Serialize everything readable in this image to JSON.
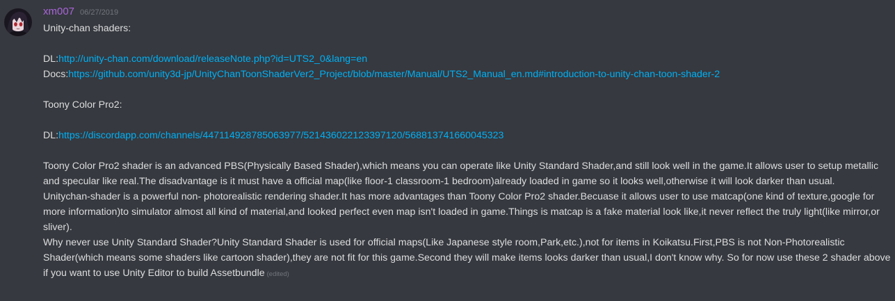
{
  "message": {
    "author": {
      "name": "xm007",
      "color": "#a865d8",
      "avatar": "anime-avatar"
    },
    "timestamp": "06/27/2019",
    "edited_label": "(edited)",
    "lines": {
      "l1": "Unity-chan shaders:",
      "dl1_label": "DL:",
      "dl1_link": "http://unity-chan.com/download/releaseNote.php?id=UTS2_0&lang=en",
      "docs_label": "Docs:",
      "docs_link": "https://github.com/unity3d-jp/UnityChanToonShaderVer2_Project/blob/master/Manual/UTS2_Manual_en.md#introduction-to-unity-chan-toon-shader-2",
      "l2": "Toony Color Pro2:",
      "dl2_label": "DL:",
      "dl2_link": "https://discordapp.com/channels/447114928785063977/521436022123397120/568813741660045323",
      "p1": "Toony Color Pro2 shader is an advanced PBS(Physically Based Shader),which means you can operate like Unity Standard Shader,and still look well in the game.It allows user to setup metallic and specular like real.The disadvantage is it must have a official map(like floor-1 classroom-1 bedroom)already loaded in game so it looks well,otherwise it will look darker than usual.",
      "p2": "Unitychan-shader is a powerful non- photorealistic rendering shader.It has more advantages than Toony Color Pro2 shader.Becuase it allows user to use matcap(one kind of texture,google for more information)to simulator almost all kind of material,and looked perfect even map isn't loaded in game.Things is matcap is a fake material look like,it never reflect the truly light(like mirror,or sliver).",
      "p3": "Why never use Unity Standard Shader?Unity Standard Shader is used for official maps(Like Japanese style room,Park,etc.),not for items in Koikatsu.First,PBS is not Non-Photorealistic Shader(which means some shaders like cartoon shader),they are not fit for this game.Second they will make items looks darker than usual,I don't know why. So for now use these 2 shader above if you want to use Unity Editor to build Assetbundle"
    }
  },
  "colors": {
    "background": "#36393f",
    "text": "#dcddde",
    "link": "#00b0f4",
    "muted": "#72767d"
  }
}
